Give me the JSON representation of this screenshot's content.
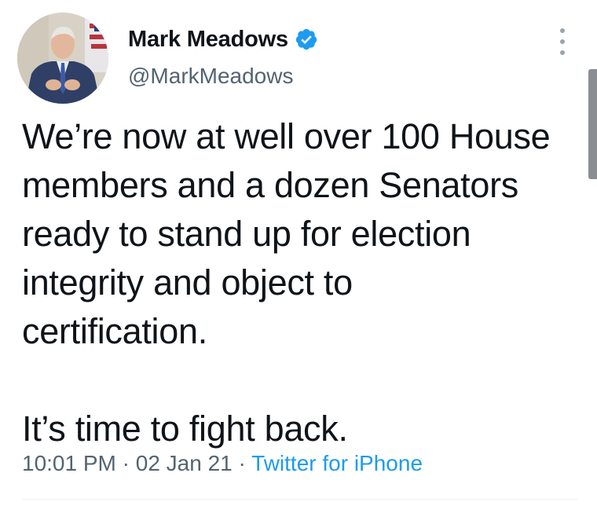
{
  "tweet": {
    "author": {
      "display_name": "Mark Meadows",
      "handle": "@MarkMeadows",
      "verified": true
    },
    "text_paragraphs": [
      "We’re now at well over 100 House\nmembers and a dozen Senators\nready to stand up for election\nintegrity and object to\ncertification.",
      "It’s time to fight back."
    ],
    "time": "10:01 PM",
    "separator": " · ",
    "date": "02 Jan 21",
    "source": "Twitter for iPhone"
  },
  "colors": {
    "text": "#0f1419",
    "secondary": "#536471",
    "accent": "#1d9bf0"
  },
  "icons": {
    "verified": "verified-badge-icon",
    "more": "more-options-icon"
  }
}
